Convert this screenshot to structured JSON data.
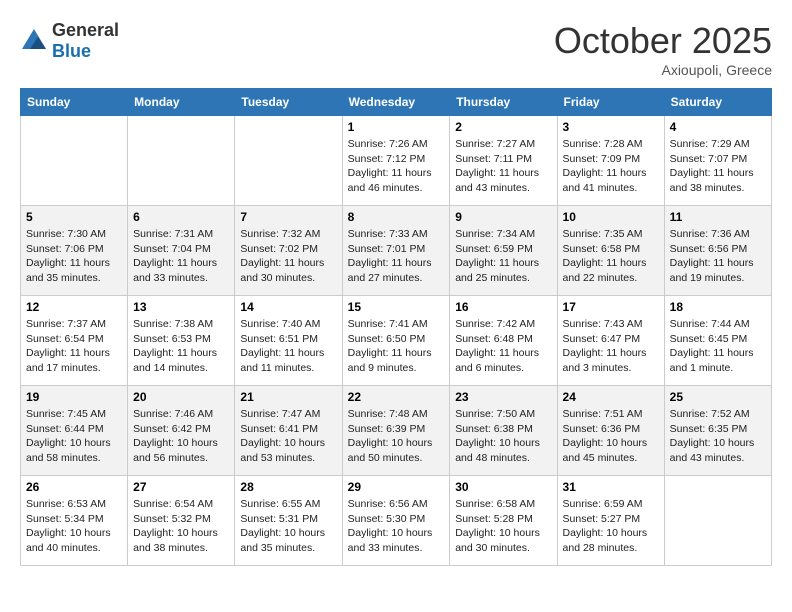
{
  "header": {
    "logo_general": "General",
    "logo_blue": "Blue",
    "month": "October 2025",
    "location": "Axioupoli, Greece"
  },
  "days_of_week": [
    "Sunday",
    "Monday",
    "Tuesday",
    "Wednesday",
    "Thursday",
    "Friday",
    "Saturday"
  ],
  "weeks": [
    [
      {
        "day": "",
        "info": ""
      },
      {
        "day": "",
        "info": ""
      },
      {
        "day": "",
        "info": ""
      },
      {
        "day": "1",
        "info": "Sunrise: 7:26 AM\nSunset: 7:12 PM\nDaylight: 11 hours\nand 46 minutes."
      },
      {
        "day": "2",
        "info": "Sunrise: 7:27 AM\nSunset: 7:11 PM\nDaylight: 11 hours\nand 43 minutes."
      },
      {
        "day": "3",
        "info": "Sunrise: 7:28 AM\nSunset: 7:09 PM\nDaylight: 11 hours\nand 41 minutes."
      },
      {
        "day": "4",
        "info": "Sunrise: 7:29 AM\nSunset: 7:07 PM\nDaylight: 11 hours\nand 38 minutes."
      }
    ],
    [
      {
        "day": "5",
        "info": "Sunrise: 7:30 AM\nSunset: 7:06 PM\nDaylight: 11 hours\nand 35 minutes."
      },
      {
        "day": "6",
        "info": "Sunrise: 7:31 AM\nSunset: 7:04 PM\nDaylight: 11 hours\nand 33 minutes."
      },
      {
        "day": "7",
        "info": "Sunrise: 7:32 AM\nSunset: 7:02 PM\nDaylight: 11 hours\nand 30 minutes."
      },
      {
        "day": "8",
        "info": "Sunrise: 7:33 AM\nSunset: 7:01 PM\nDaylight: 11 hours\nand 27 minutes."
      },
      {
        "day": "9",
        "info": "Sunrise: 7:34 AM\nSunset: 6:59 PM\nDaylight: 11 hours\nand 25 minutes."
      },
      {
        "day": "10",
        "info": "Sunrise: 7:35 AM\nSunset: 6:58 PM\nDaylight: 11 hours\nand 22 minutes."
      },
      {
        "day": "11",
        "info": "Sunrise: 7:36 AM\nSunset: 6:56 PM\nDaylight: 11 hours\nand 19 minutes."
      }
    ],
    [
      {
        "day": "12",
        "info": "Sunrise: 7:37 AM\nSunset: 6:54 PM\nDaylight: 11 hours\nand 17 minutes."
      },
      {
        "day": "13",
        "info": "Sunrise: 7:38 AM\nSunset: 6:53 PM\nDaylight: 11 hours\nand 14 minutes."
      },
      {
        "day": "14",
        "info": "Sunrise: 7:40 AM\nSunset: 6:51 PM\nDaylight: 11 hours\nand 11 minutes."
      },
      {
        "day": "15",
        "info": "Sunrise: 7:41 AM\nSunset: 6:50 PM\nDaylight: 11 hours\nand 9 minutes."
      },
      {
        "day": "16",
        "info": "Sunrise: 7:42 AM\nSunset: 6:48 PM\nDaylight: 11 hours\nand 6 minutes."
      },
      {
        "day": "17",
        "info": "Sunrise: 7:43 AM\nSunset: 6:47 PM\nDaylight: 11 hours\nand 3 minutes."
      },
      {
        "day": "18",
        "info": "Sunrise: 7:44 AM\nSunset: 6:45 PM\nDaylight: 11 hours\nand 1 minute."
      }
    ],
    [
      {
        "day": "19",
        "info": "Sunrise: 7:45 AM\nSunset: 6:44 PM\nDaylight: 10 hours\nand 58 minutes."
      },
      {
        "day": "20",
        "info": "Sunrise: 7:46 AM\nSunset: 6:42 PM\nDaylight: 10 hours\nand 56 minutes."
      },
      {
        "day": "21",
        "info": "Sunrise: 7:47 AM\nSunset: 6:41 PM\nDaylight: 10 hours\nand 53 minutes."
      },
      {
        "day": "22",
        "info": "Sunrise: 7:48 AM\nSunset: 6:39 PM\nDaylight: 10 hours\nand 50 minutes."
      },
      {
        "day": "23",
        "info": "Sunrise: 7:50 AM\nSunset: 6:38 PM\nDaylight: 10 hours\nand 48 minutes."
      },
      {
        "day": "24",
        "info": "Sunrise: 7:51 AM\nSunset: 6:36 PM\nDaylight: 10 hours\nand 45 minutes."
      },
      {
        "day": "25",
        "info": "Sunrise: 7:52 AM\nSunset: 6:35 PM\nDaylight: 10 hours\nand 43 minutes."
      }
    ],
    [
      {
        "day": "26",
        "info": "Sunrise: 6:53 AM\nSunset: 5:34 PM\nDaylight: 10 hours\nand 40 minutes."
      },
      {
        "day": "27",
        "info": "Sunrise: 6:54 AM\nSunset: 5:32 PM\nDaylight: 10 hours\nand 38 minutes."
      },
      {
        "day": "28",
        "info": "Sunrise: 6:55 AM\nSunset: 5:31 PM\nDaylight: 10 hours\nand 35 minutes."
      },
      {
        "day": "29",
        "info": "Sunrise: 6:56 AM\nSunset: 5:30 PM\nDaylight: 10 hours\nand 33 minutes."
      },
      {
        "day": "30",
        "info": "Sunrise: 6:58 AM\nSunset: 5:28 PM\nDaylight: 10 hours\nand 30 minutes."
      },
      {
        "day": "31",
        "info": "Sunrise: 6:59 AM\nSunset: 5:27 PM\nDaylight: 10 hours\nand 28 minutes."
      },
      {
        "day": "",
        "info": ""
      }
    ]
  ]
}
